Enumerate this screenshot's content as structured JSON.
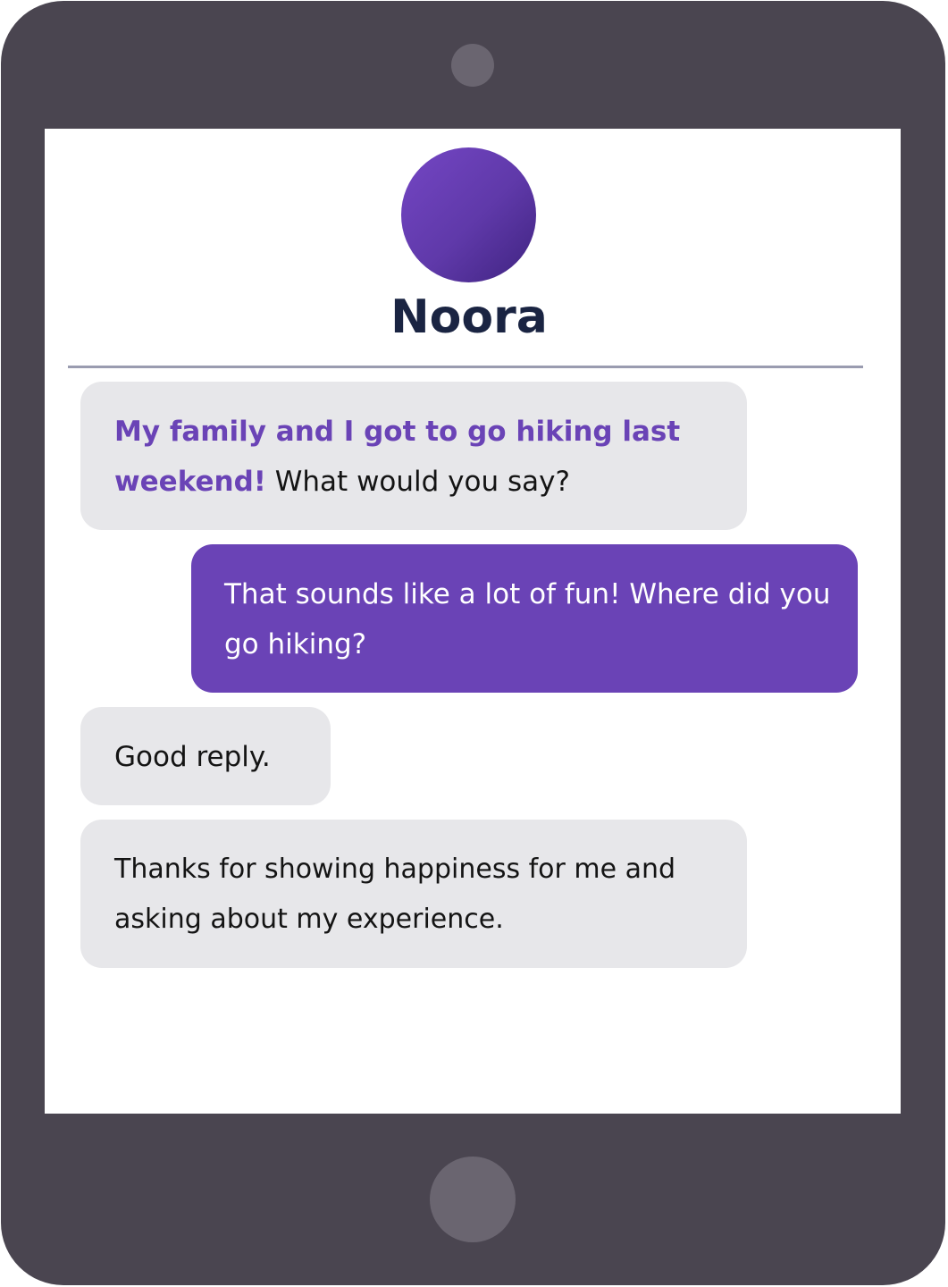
{
  "contact": {
    "name": "Noora"
  },
  "colors": {
    "device_frame": "#4a4550",
    "avatar": "#6a43b6",
    "outgoing_bubble": "#6a43b6",
    "incoming_bubble": "#e7e7ea",
    "name_text": "#1a2442"
  },
  "messages": [
    {
      "from": "contact",
      "highlight": "My family and I got to go hiking last weekend!",
      "text": " What would you say?"
    },
    {
      "from": "user",
      "text": "That sounds like a lot of fun! Where did you go hiking?"
    },
    {
      "from": "contact",
      "text": "Good reply."
    },
    {
      "from": "contact",
      "text": "Thanks for showing happiness for me and asking about my experience."
    }
  ]
}
